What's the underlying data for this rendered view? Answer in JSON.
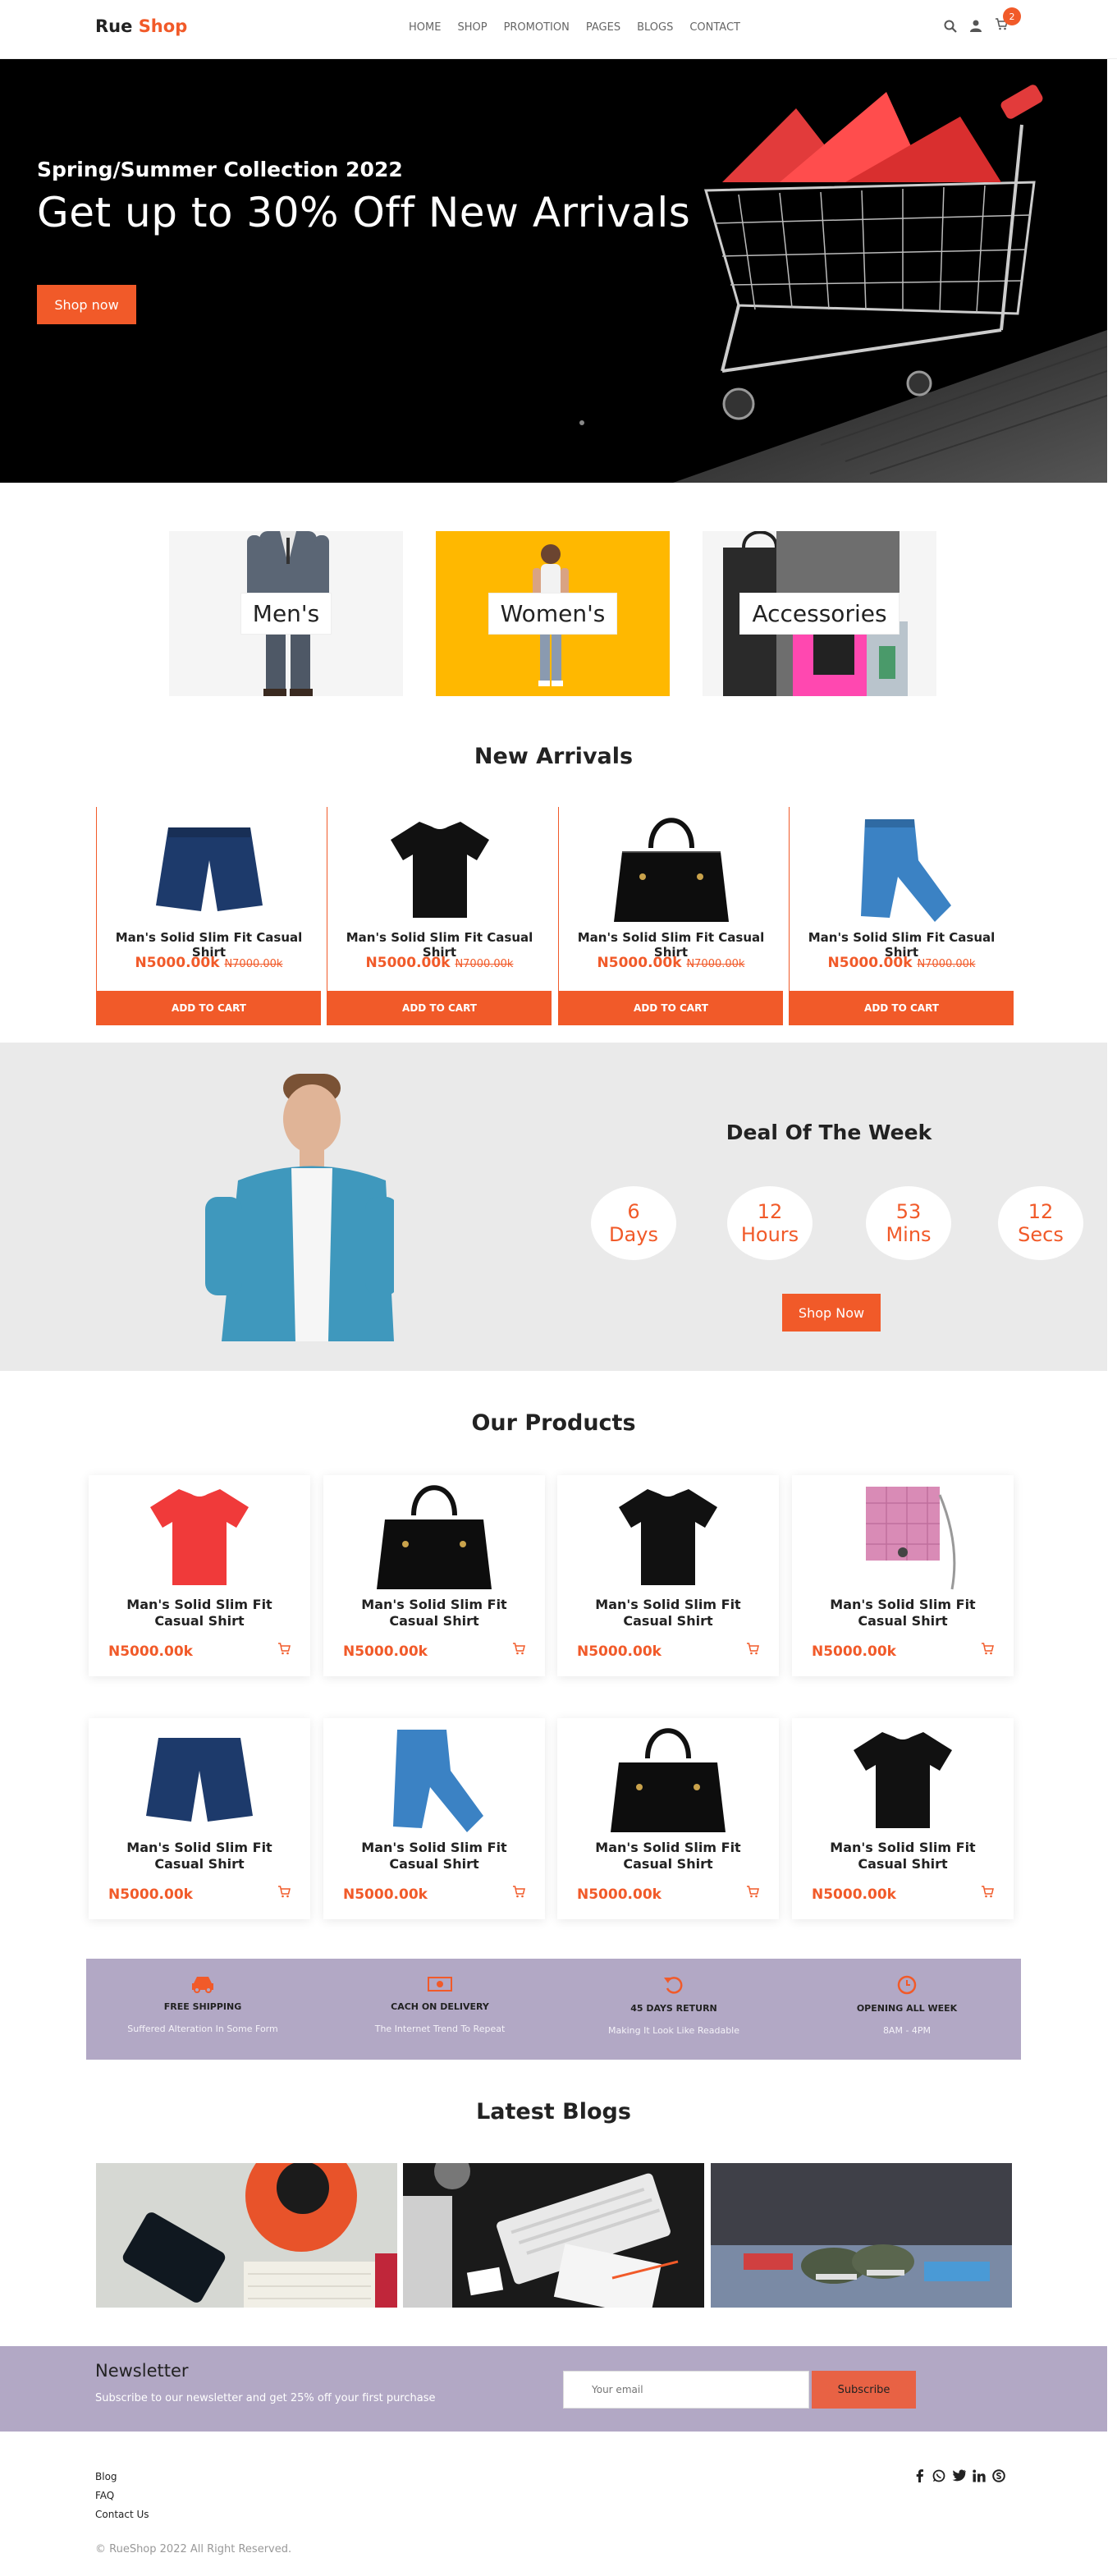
{
  "header": {
    "logo_part1": "Rue",
    "logo_part2": "Shop",
    "nav": [
      "HOME",
      "SHOP",
      "PROMOTION",
      "PAGES",
      "BLOGS",
      "CONTACT"
    ],
    "cart_count": "2"
  },
  "hero": {
    "subtitle": "Spring/Summer Collection 2022",
    "title": "Get up to 30% Off New Arrivals",
    "button": "Shop now"
  },
  "categories": [
    {
      "label": "Men's"
    },
    {
      "label": "Women's"
    },
    {
      "label": "Accessories"
    }
  ],
  "new_arrivals": {
    "title": "New Arrivals",
    "items": [
      {
        "name": "Man's Solid Slim Fit Casual Shirt",
        "price": "N5000.00k",
        "old_price": "N7000.00k",
        "button": "ADD TO CART",
        "icon": "shorts-icon"
      },
      {
        "name": "Man's Solid Slim Fit Casual Shirt",
        "price": "N5000.00k",
        "old_price": "N7000.00k",
        "button": "ADD TO CART",
        "icon": "tshirt-icon"
      },
      {
        "name": "Man's Solid Slim Fit Casual Shirt",
        "price": "N5000.00k",
        "old_price": "N7000.00k",
        "button": "ADD TO CART",
        "icon": "handbag-icon"
      },
      {
        "name": "Man's Solid Slim Fit Casual Shirt",
        "price": "N5000.00k",
        "old_price": "N7000.00k",
        "button": "ADD TO CART",
        "icon": "jeans-icon"
      }
    ]
  },
  "deal": {
    "title": "Deal Of The Week",
    "timer": [
      {
        "value": "6",
        "unit": "Days"
      },
      {
        "value": "12",
        "unit": "Hours"
      },
      {
        "value": "53",
        "unit": "Mins"
      },
      {
        "value": "12",
        "unit": "Secs"
      }
    ],
    "button": "Shop Now"
  },
  "our_products": {
    "title": "Our Products",
    "items": [
      {
        "name": "Man's Solid Slim Fit Casual Shirt",
        "price": "N5000.00k"
      },
      {
        "name": "Man's Solid Slim Fit Casual Shirt",
        "price": "N5000.00k"
      },
      {
        "name": "Man's Solid Slim Fit Casual Shirt",
        "price": "N5000.00k"
      },
      {
        "name": "Man's Solid Slim Fit Casual Shirt",
        "price": "N5000.00k"
      },
      {
        "name": "Man's Solid Slim Fit Casual Shirt",
        "price": "N5000.00k"
      },
      {
        "name": "Man's Solid Slim Fit Casual Shirt",
        "price": "N5000.00k"
      },
      {
        "name": "Man's Solid Slim Fit Casual Shirt",
        "price": "N5000.00k"
      },
      {
        "name": "Man's Solid Slim Fit Casual Shirt",
        "price": "N5000.00k"
      }
    ]
  },
  "features": [
    {
      "title": "FREE SHIPPING",
      "subtitle": "Suffered Alteration In Some Form",
      "icon": "car-icon"
    },
    {
      "title": "CACH ON DELIVERY",
      "subtitle": "The Internet Trend To Repeat",
      "icon": "money-icon"
    },
    {
      "title": "45 DAYS RETURN",
      "subtitle": "Making It Look Like Readable",
      "icon": "return-icon"
    },
    {
      "title": "OPENING ALL WEEK",
      "subtitle": "8AM - 4PM",
      "icon": "clock-icon"
    }
  ],
  "blogs": {
    "title": "Latest Blogs"
  },
  "newsletter": {
    "title": "Newsletter",
    "subtitle": "Subscribe to our newsletter and get 25% off your first purchase",
    "placeholder": "Your email",
    "button": "Subscribe"
  },
  "footer": {
    "links": [
      "Blog",
      "FAQ",
      "Contact Us"
    ],
    "copyright": "© RueShop 2022 All Right Reserved."
  },
  "colors": {
    "accent": "#f15a29",
    "lilac": "#b2a8c5",
    "deal_bg": "#eaeaea"
  }
}
